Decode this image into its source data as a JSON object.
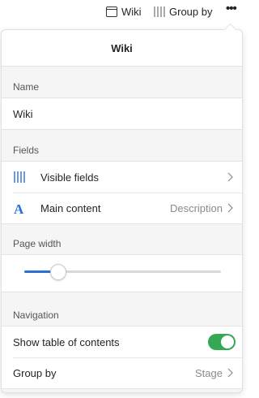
{
  "toolbar": {
    "view_label": "Wiki",
    "group_label": "Group by",
    "more_label": "•••"
  },
  "panel": {
    "title": "Wiki",
    "name_section": {
      "label": "Name",
      "value": "Wiki"
    },
    "fields_section": {
      "label": "Fields",
      "items": [
        {
          "label": "Visible fields",
          "value": "",
          "icon": "columns-icon"
        },
        {
          "label": "Main content",
          "value": "Description",
          "icon": "text-format-icon"
        }
      ]
    },
    "page_width_section": {
      "label": "Page width",
      "value": 0.17
    },
    "navigation_section": {
      "label": "Navigation",
      "items": [
        {
          "label": "Show table of contents",
          "toggle_on": true
        },
        {
          "label": "Group by",
          "value": "Stage"
        }
      ]
    }
  },
  "colors": {
    "accent": "#2b6fd6",
    "toggle_on": "#34a853",
    "panel_bg": "#f5f5f5"
  }
}
